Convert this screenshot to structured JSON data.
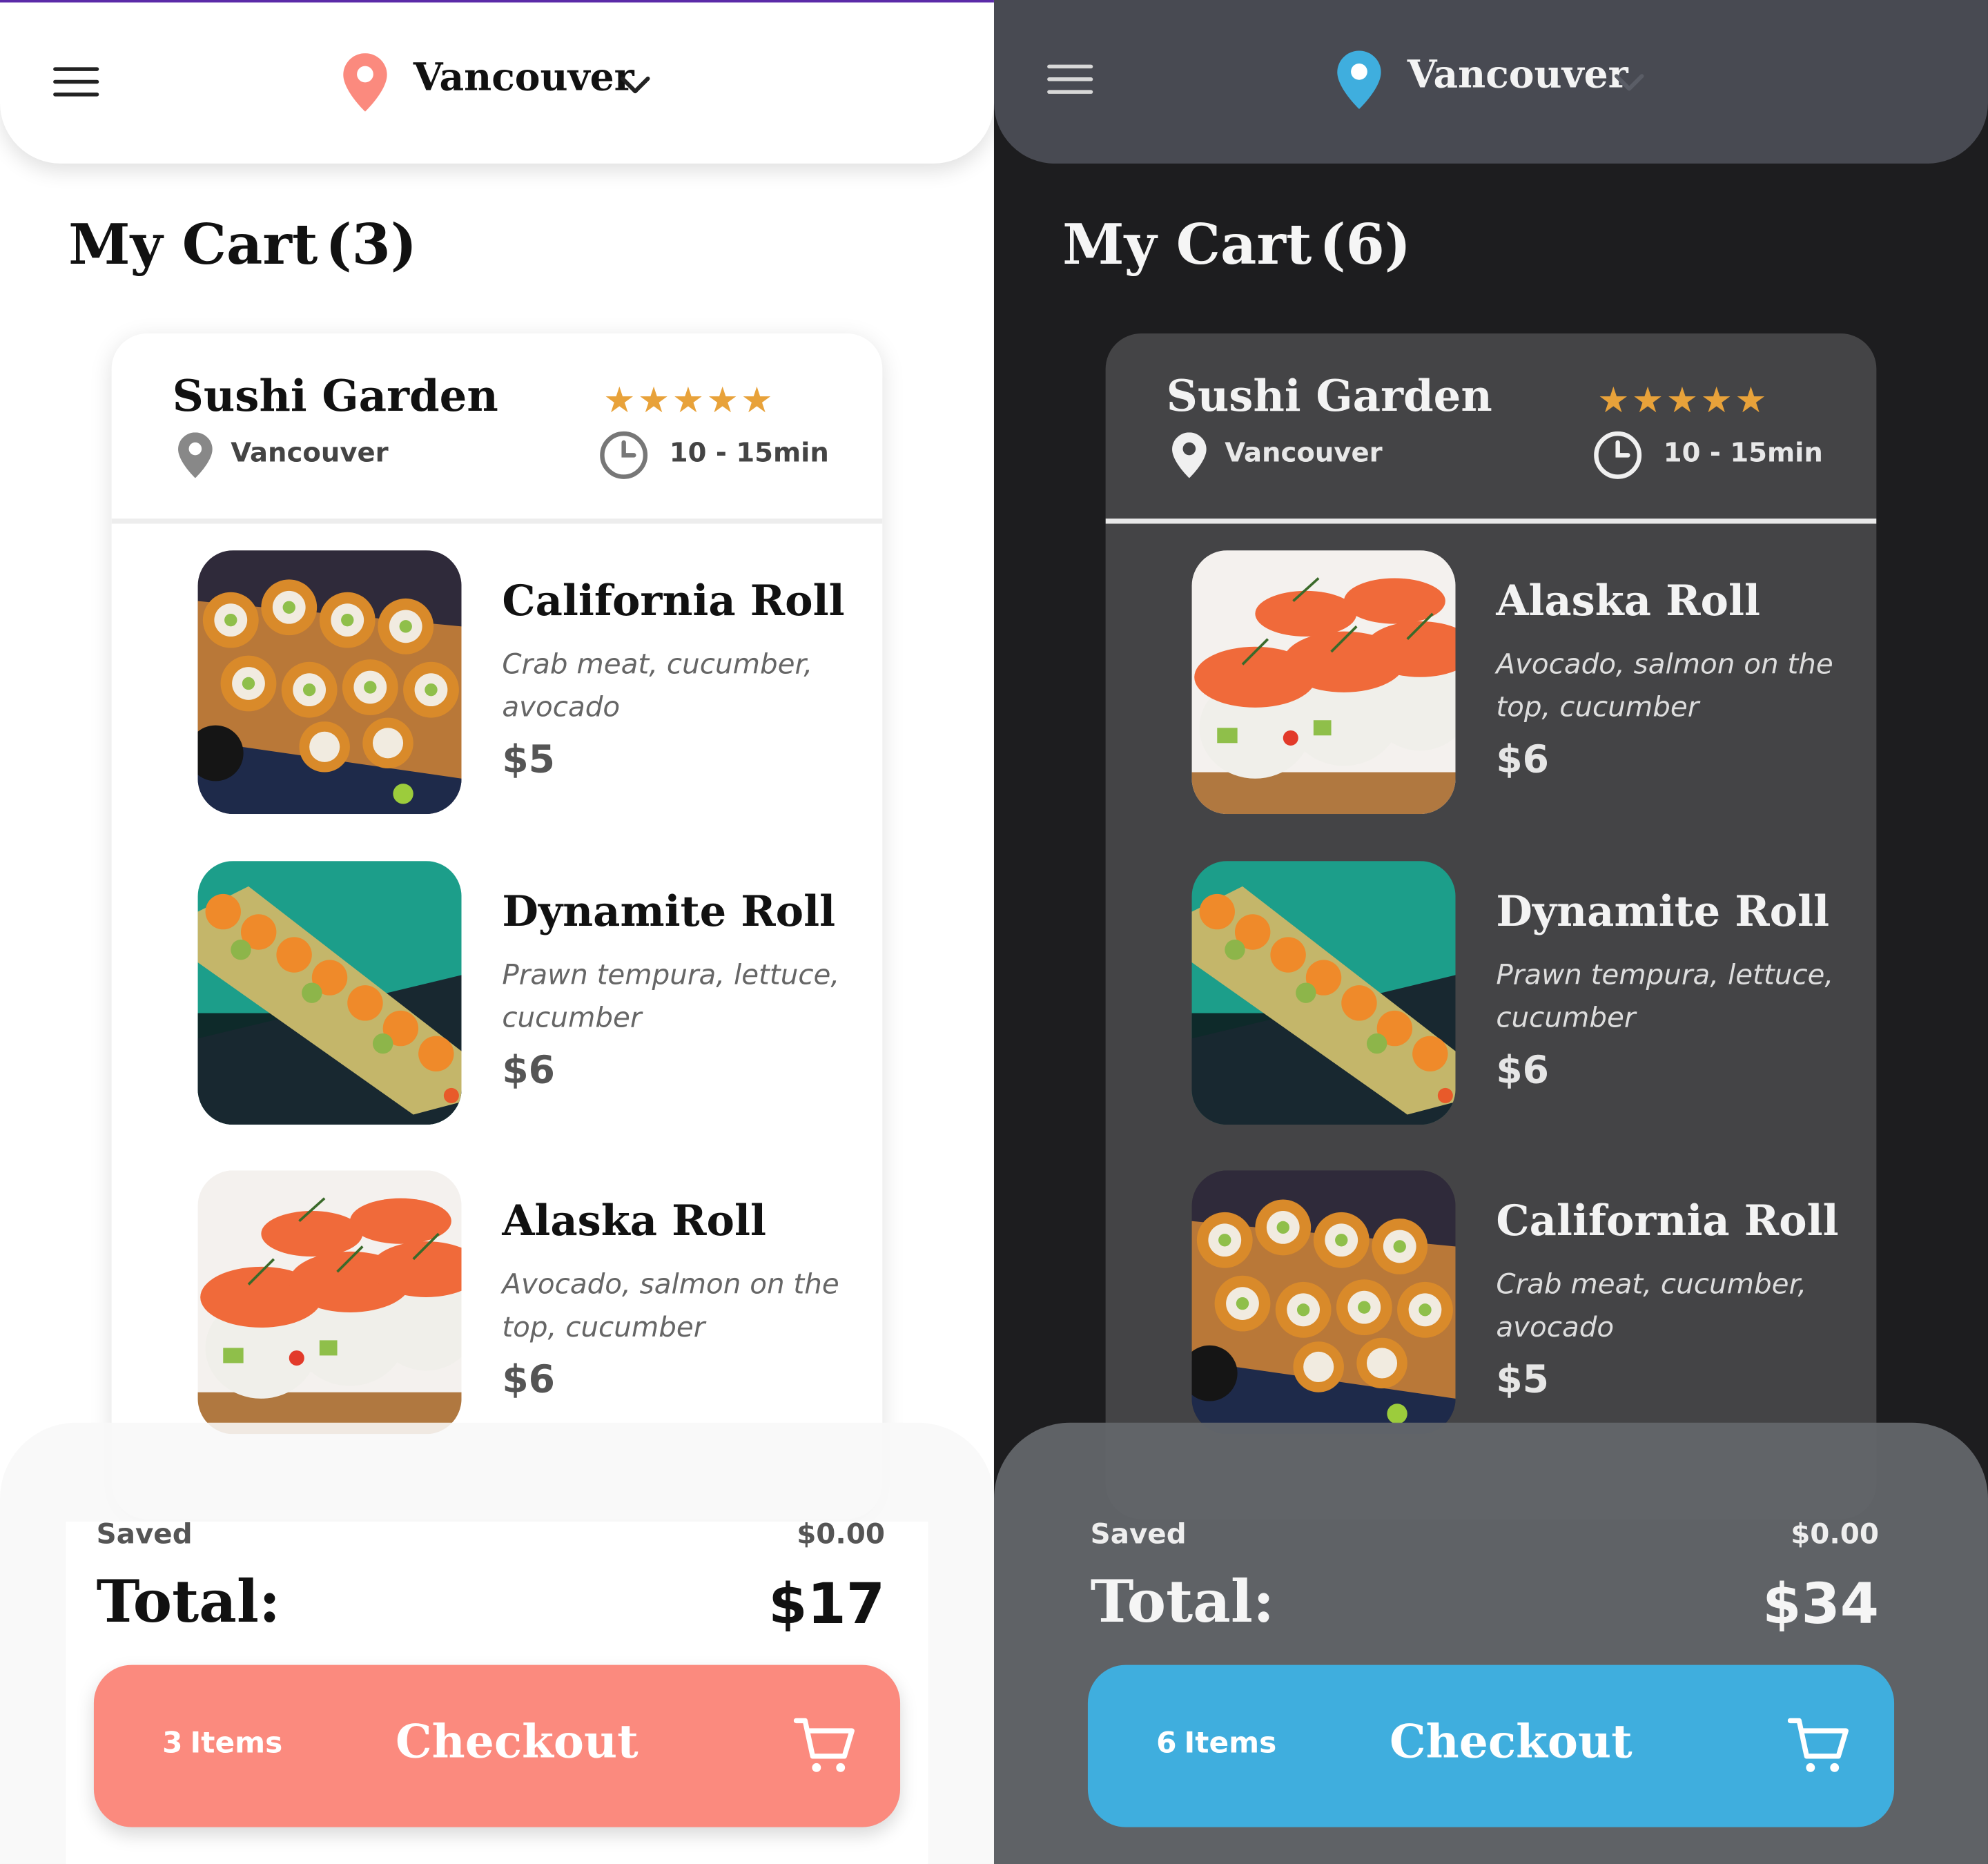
{
  "light": {
    "location": "Vancouver",
    "title": "My Cart",
    "title_count": "(3)",
    "restaurant": {
      "name": "Sushi Garden",
      "city": "Vancouver",
      "stars": "★★★★★",
      "eta": "10 - 15min"
    },
    "items": [
      {
        "name": "California Roll",
        "desc": "Crab meat, cucumber, avocado",
        "price": "$5",
        "image": "california-roll"
      },
      {
        "name": "Dynamite Roll",
        "desc": "Prawn tempura, lettuce, cucumber",
        "price": "$6",
        "image": "dynamite-roll"
      },
      {
        "name": "Alaska Roll",
        "desc": "Avocado, salmon on the top, cucumber",
        "price": "$6",
        "image": "alaska-roll"
      }
    ],
    "saved_label": "Saved",
    "saved_value": "$0.00",
    "total_label": "Total:",
    "total_value": "$17",
    "checkout": {
      "count": "3",
      "items_word": "Items",
      "label": "Checkout"
    },
    "accent": "#fb8a7e"
  },
  "dark": {
    "location": "Vancouver",
    "title": "My Cart",
    "title_count": "(6)",
    "restaurant": {
      "name": "Sushi Garden",
      "city": "Vancouver",
      "stars": "★★★★★",
      "eta": "10 - 15min"
    },
    "items": [
      {
        "name": "Alaska Roll",
        "desc": "Avocado, salmon on the top, cucumber",
        "price": "$6",
        "image": "alaska-roll"
      },
      {
        "name": "Dynamite Roll",
        "desc": "Prawn tempura, lettuce, cucumber",
        "price": "$6",
        "image": "dynamite-roll"
      },
      {
        "name": "California Roll",
        "desc": "Crab meat, cucumber, avocado",
        "price": "$5",
        "image": "california-roll"
      }
    ],
    "saved_label": "Saved",
    "saved_value": "$0.00",
    "total_label": "Total:",
    "total_value": "$34",
    "checkout": {
      "count": "6",
      "items_word": "Items",
      "label": "Checkout"
    },
    "accent": "#3faede"
  },
  "icons": {
    "menu": "hamburger-icon",
    "location": "map-pin-icon",
    "dropdown": "chevron-down-icon",
    "time": "clock-icon",
    "cart": "shopping-cart-icon"
  }
}
